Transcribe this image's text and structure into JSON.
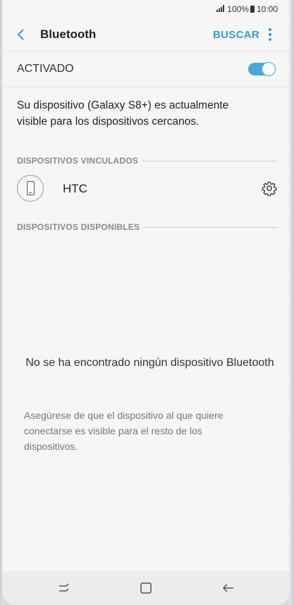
{
  "status_bar": {
    "signal_icon": "signal-bars-icon",
    "battery_percent": "100%",
    "battery_icon": "battery-icon",
    "time": "10:00"
  },
  "app_bar": {
    "back_icon": "arrow-left-icon",
    "title": "Bluetooth",
    "scan_label": "BUSCAR",
    "more_icon": "vertical-dots-icon",
    "accent_color": "#3a9bc4"
  },
  "toggle": {
    "label": "ACTIVADO",
    "on": true,
    "color": "#49a9d6"
  },
  "visibility_text": "Su dispositivo (Galaxy S8+) es actualmente visible para los dispositivos cercanos.",
  "paired": {
    "header": "DISPOSITIVOS VINCULADOS",
    "devices": [
      {
        "name": "HTC",
        "icon": "phone-icon",
        "settings_icon": "gear-icon"
      }
    ]
  },
  "available": {
    "header": "DISPOSITIVOS DISPONIBLES",
    "empty_title": "No se ha encontrado ningún dispositivo Bluetooth",
    "empty_hint": "Asegúrese de que el dispositivo al que quiere conectarse es visible para el resto de los dispositivos."
  },
  "nav_bar": {
    "recents_icon": "recents-icon",
    "home_icon": "home-icon",
    "back_icon": "back-arrow-icon"
  }
}
